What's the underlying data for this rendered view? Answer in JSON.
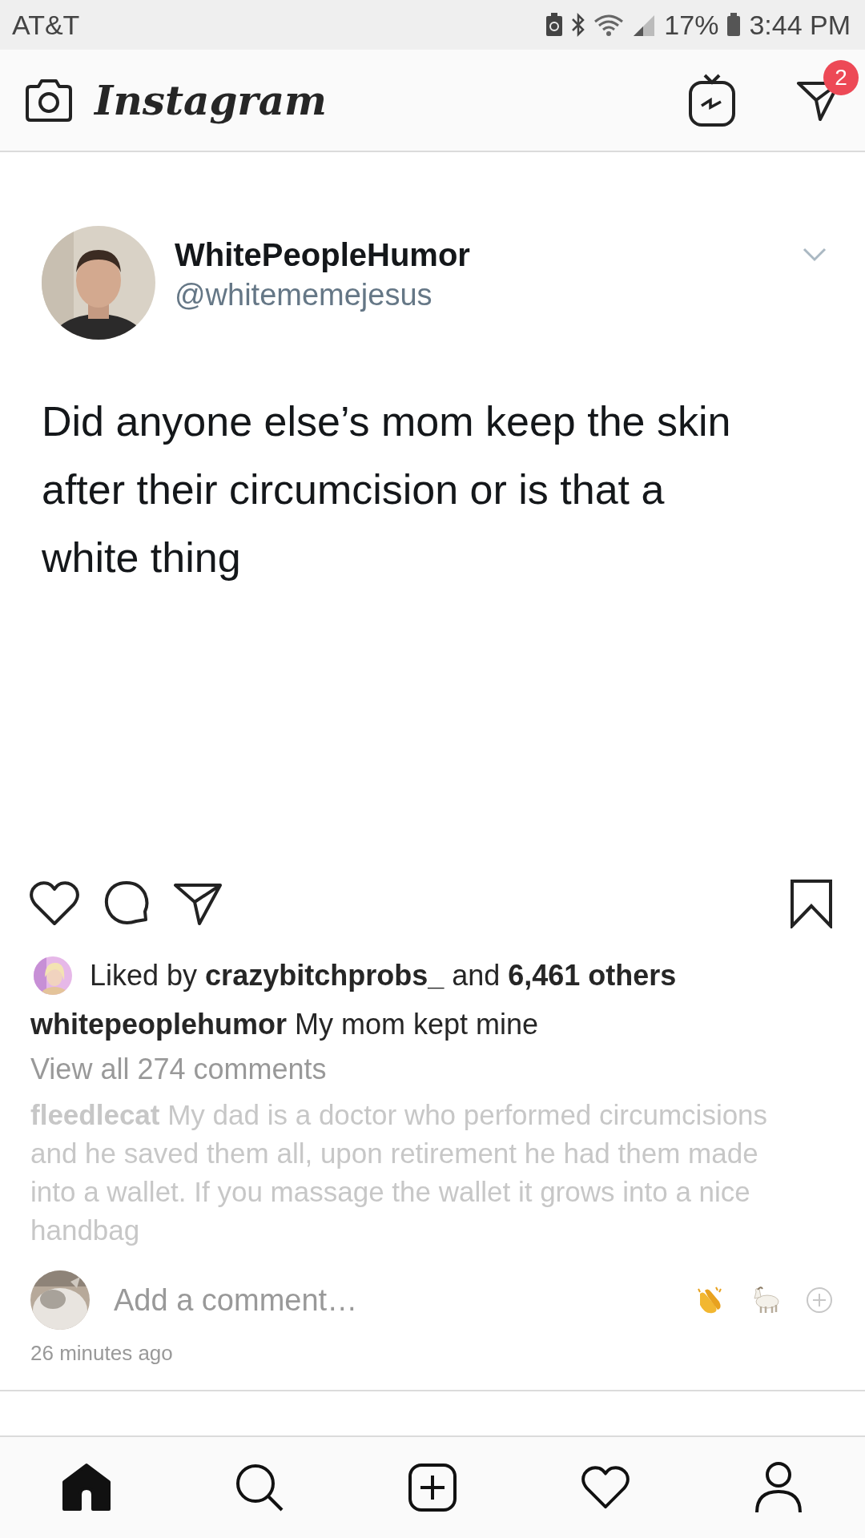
{
  "status_bar": {
    "carrier": "AT&T",
    "battery": "17%",
    "time": "3:44 PM"
  },
  "app_bar": {
    "title": "Instagram",
    "direct_badge": "2"
  },
  "tweet": {
    "name": "WhitePeopleHumor",
    "handle": "@whitememejesus",
    "text": "Did anyone else’s mom keep the skin after their circumcision or is that a white thing"
  },
  "post": {
    "liked_by": "Liked by **crazybitchprobs_** and **6,461 others**",
    "caption": "**whitepeoplehumor** My mom kept mine",
    "view_comments": "View all 274 comments",
    "comments": [
      {
        "text": "**fleedlecat** My dad is a doctor who performed circumcisions and he saved them all, upon retirement he had them made into a wallet. If you massage the wallet it grows into a nice handbag"
      }
    ],
    "comment_field": {
      "placeholder": "Add a comment…"
    },
    "time": "26 minutes ago"
  },
  "bottom_nav": [
    {
      "kind": "home",
      "selected": true
    },
    {
      "kind": "search",
      "selected": false
    },
    {
      "kind": "add",
      "selected": false
    },
    {
      "kind": "activity",
      "selected": false
    },
    {
      "kind": "profile",
      "selected": false
    }
  ]
}
